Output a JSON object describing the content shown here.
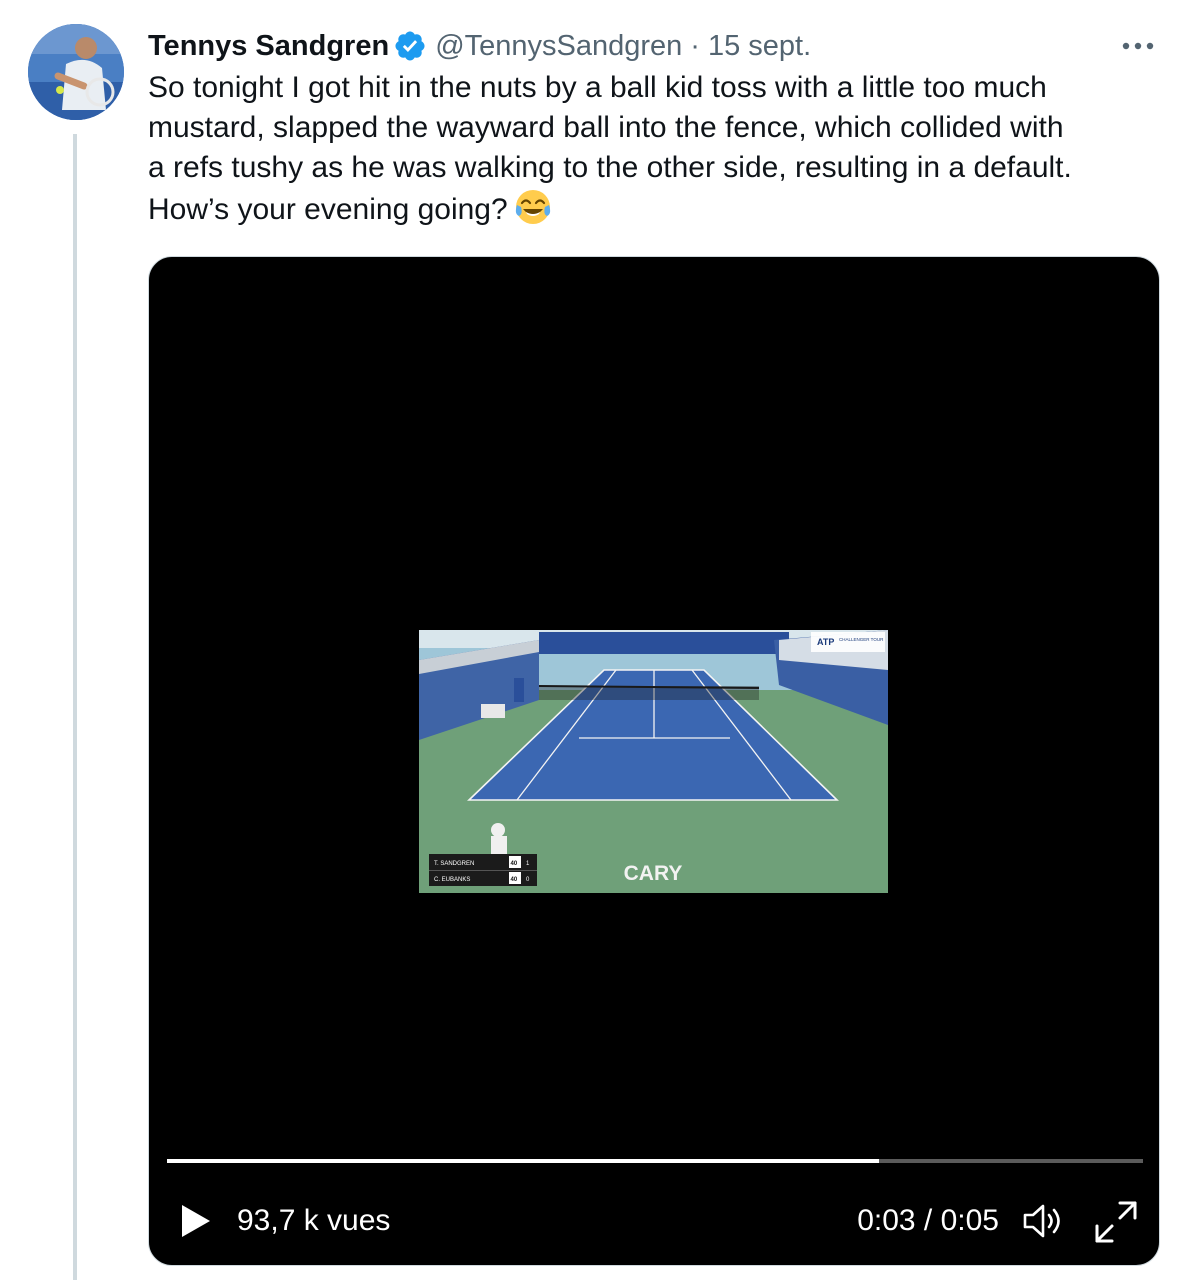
{
  "author": {
    "name": "Tennys Sandgren",
    "handle": "@TennysSandgren",
    "separator": "·",
    "date": "15 sept."
  },
  "tweet": {
    "lines": [
      "So tonight I got hit in the nuts by a ball kid toss with a little too much",
      "mustard, slapped the wayward ball into the fence, which collided with",
      "a refs tushy as he was walking to the other side, resulting in a default.",
      "How’s your evening going?"
    ],
    "emoji": "face-with-tears-of-joy"
  },
  "video": {
    "overlay_text": "CARY",
    "sponsor": "ATP",
    "tour_label": "CHALLENGER TOUR",
    "scoreboard": [
      {
        "player": "T. SANDGREN",
        "points": "40",
        "games": "1"
      },
      {
        "player": "C. EUBANKS",
        "points": "40",
        "games": "0"
      }
    ],
    "views": "93,7 k vues",
    "time": "0:03 / 0:05",
    "progress": 0.73
  },
  "colors": {
    "verified": "#1d9bf0",
    "thread_line": "#cfd9de",
    "secondary_text": "#536471"
  },
  "icons": {
    "verified": "verified-badge-icon",
    "more": "more-icon",
    "play": "play-icon",
    "volume": "volume-icon",
    "fullscreen": "fullscreen-icon"
  }
}
